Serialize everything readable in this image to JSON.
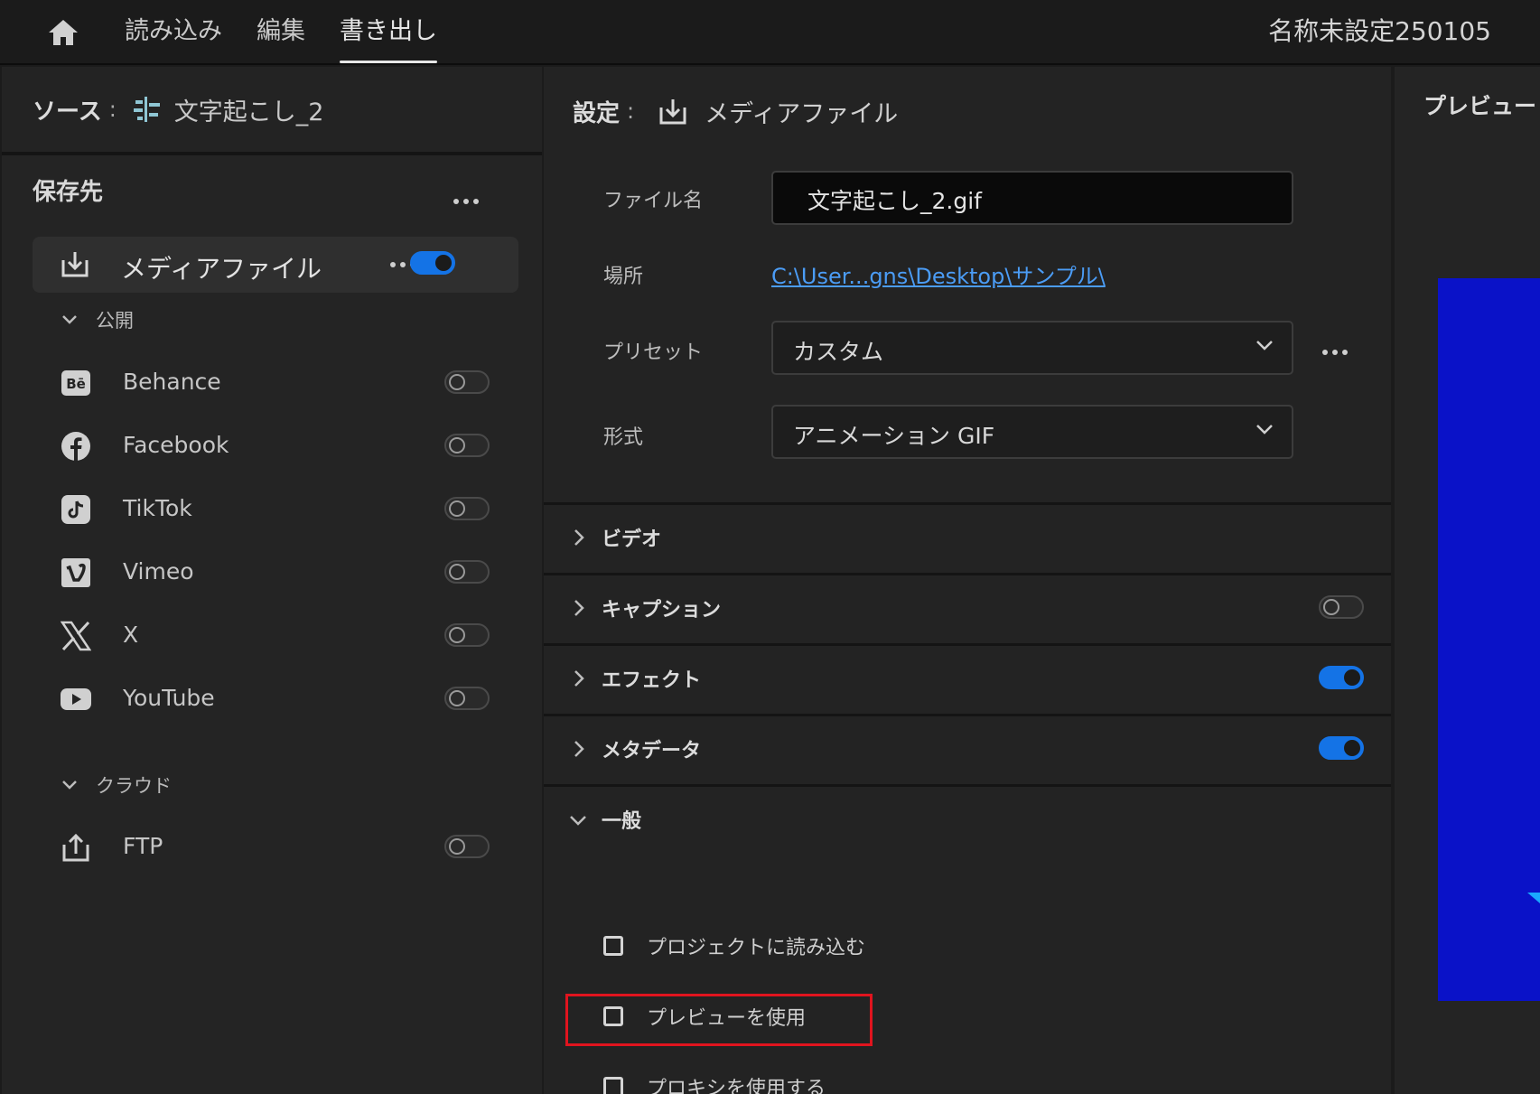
{
  "topbar": {
    "tabs": [
      "読み込み",
      "編集",
      "書き出し"
    ],
    "active_tab": "書き出し",
    "project_title": "名称未設定250105"
  },
  "source": {
    "key": "ソース",
    "colon": ":",
    "value": "文字起こし_2"
  },
  "destinations": {
    "title": "保存先",
    "media": {
      "label": "メディアファイル",
      "enabled": true
    },
    "publish_group": "公開",
    "publish_items": [
      {
        "label": "Behance",
        "icon": "behance-icon",
        "enabled": false
      },
      {
        "label": "Facebook",
        "icon": "facebook-icon",
        "enabled": false
      },
      {
        "label": "TikTok",
        "icon": "tiktok-icon",
        "enabled": false
      },
      {
        "label": "Vimeo",
        "icon": "vimeo-icon",
        "enabled": false
      },
      {
        "label": "X",
        "icon": "x-icon",
        "enabled": false
      },
      {
        "label": "YouTube",
        "icon": "youtube-icon",
        "enabled": false
      }
    ],
    "cloud_group": "クラウド",
    "cloud_items": [
      {
        "label": "FTP",
        "icon": "upload-icon",
        "enabled": false
      }
    ]
  },
  "settings": {
    "key": "設定",
    "colon": ":",
    "value": "メディアファイル",
    "filename_label": "ファイル名",
    "filename_value": "文字起こし_2.gif",
    "location_label": "場所",
    "location_value": "C:\\User...gns\\Desktop\\サンプル\\",
    "preset_label": "プリセット",
    "preset_value": "カスタム",
    "format_label": "形式",
    "format_value": "アニメーション GIF",
    "sections": [
      {
        "label": "ビデオ",
        "has_toggle": false
      },
      {
        "label": "キャプション",
        "has_toggle": true,
        "enabled": false
      },
      {
        "label": "エフェクト",
        "has_toggle": true,
        "enabled": true
      },
      {
        "label": "メタデータ",
        "has_toggle": true,
        "enabled": true
      }
    ],
    "general": {
      "label": "一般",
      "expanded": true,
      "options": [
        {
          "label": "プロジェクトに読み込む",
          "checked": false
        },
        {
          "label": "プレビューを使用",
          "checked": false
        },
        {
          "label": "プロキシを使用する",
          "checked": false,
          "highlighted": true
        }
      ]
    }
  },
  "preview": {
    "title": "プレビュー",
    "canvas_color": "#0a12c8"
  },
  "colors": {
    "accent": "#1473e6",
    "link": "#4b9cf5",
    "highlight_box": "#e0141e"
  }
}
